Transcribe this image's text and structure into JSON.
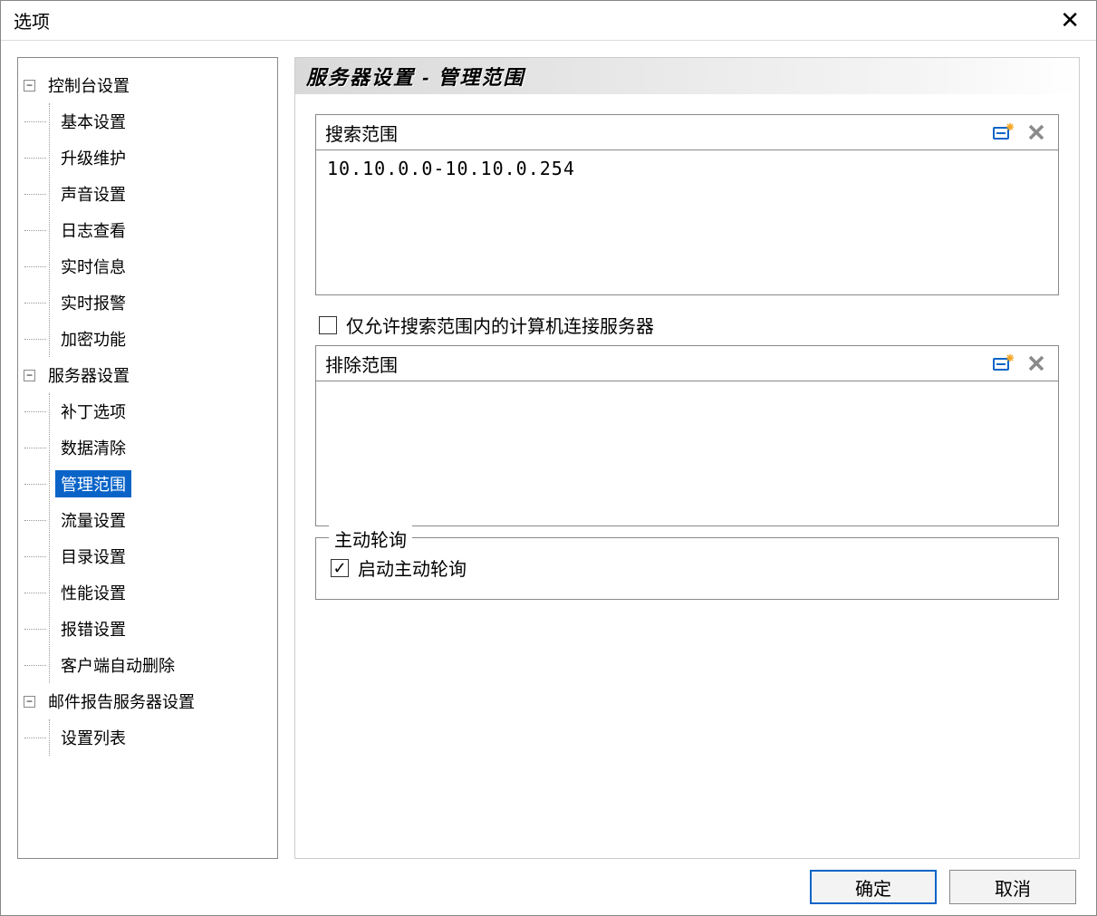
{
  "window": {
    "title": "选项"
  },
  "tree": {
    "groups": [
      {
        "label": "控制台设置",
        "expanded": true,
        "items": [
          {
            "label": "基本设置"
          },
          {
            "label": "升级维护"
          },
          {
            "label": "声音设置"
          },
          {
            "label": "日志查看"
          },
          {
            "label": "实时信息"
          },
          {
            "label": "实时报警"
          },
          {
            "label": "加密功能"
          }
        ]
      },
      {
        "label": "服务器设置",
        "expanded": true,
        "items": [
          {
            "label": "补丁选项"
          },
          {
            "label": "数据清除"
          },
          {
            "label": "管理范围",
            "selected": true
          },
          {
            "label": "流量设置"
          },
          {
            "label": "目录设置"
          },
          {
            "label": "性能设置"
          },
          {
            "label": "报错设置"
          },
          {
            "label": "客户端自动删除"
          }
        ]
      },
      {
        "label": "邮件报告服务器设置",
        "expanded": true,
        "items": [
          {
            "label": "设置列表"
          }
        ]
      }
    ]
  },
  "panel": {
    "heading": "服务器设置 - 管理范围",
    "search_scope": {
      "label": "搜索范围",
      "items": [
        "10.10.0.0-10.10.0.254"
      ]
    },
    "only_allow": {
      "checked": false,
      "label": "仅允许搜索范围内的计算机连接服务器"
    },
    "exclude_scope": {
      "label": "排除范围",
      "items": []
    },
    "polling": {
      "legend": "主动轮询",
      "enable": {
        "checked": true,
        "label": "启动主动轮询"
      }
    }
  },
  "buttons": {
    "ok": "确定",
    "cancel": "取消"
  },
  "glyphs": {
    "minus": "−",
    "check": "✓"
  }
}
